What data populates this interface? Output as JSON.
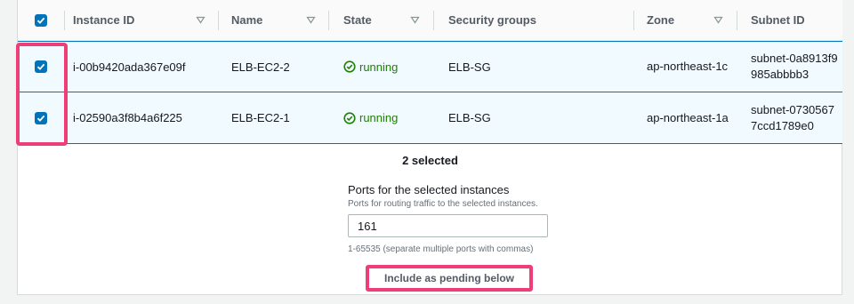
{
  "table": {
    "columns": [
      {
        "label": "Instance ID",
        "sortable": true
      },
      {
        "label": "Name",
        "sortable": true
      },
      {
        "label": "State",
        "sortable": true
      },
      {
        "label": "Security groups",
        "sortable": false
      },
      {
        "label": "Zone",
        "sortable": true
      },
      {
        "label": "Subnet ID",
        "sortable": false
      }
    ],
    "rows": [
      {
        "selected": true,
        "instance_id": "i-00b9420ada367e09f",
        "name": "ELB-EC2-2",
        "state": "running",
        "security_groups": "ELB-SG",
        "zone": "ap-northeast-1c",
        "subnet": "subnet-0a8913f9985abbbb3"
      },
      {
        "selected": true,
        "instance_id": "i-02590a3f8b4a6f225",
        "name": "ELB-EC2-1",
        "state": "running",
        "security_groups": "ELB-SG",
        "zone": "ap-northeast-1a",
        "subnet": "subnet-07305677ccd1789e0"
      }
    ]
  },
  "selection": {
    "count_label": "2 selected"
  },
  "ports": {
    "title": "Ports for the selected instances",
    "description": "Ports for routing traffic to the selected instances.",
    "value": "161",
    "hint": "1-65535 (separate multiple ports with commas)"
  },
  "actions": {
    "include_label": "Include as pending below"
  },
  "colors": {
    "accent": "#0073bb",
    "running": "#1d8102",
    "highlight": "#ee3e77"
  }
}
